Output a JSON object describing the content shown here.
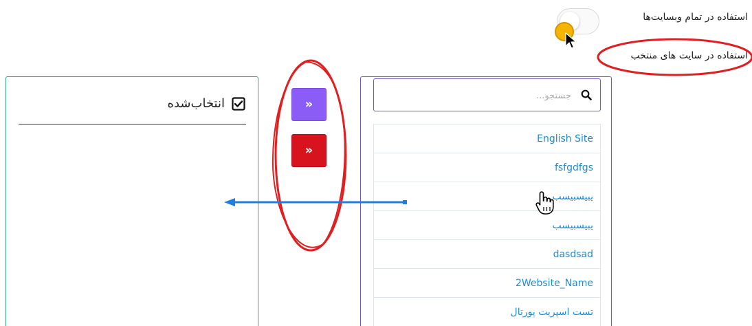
{
  "options": {
    "all_sites_label": "استفاده در تمام وبسایت‌ها",
    "selected_sites_label": "استفاده در سایت های منتخب",
    "toggle_on": false
  },
  "source": {
    "search_placeholder": "جستجو...",
    "items": [
      "English Site",
      "fsfgdfgs",
      "یبیسبیسب",
      "یبیسبیسب",
      "dasdsad",
      "2Website_Name",
      "تست اسپریت پورتال"
    ]
  },
  "actions": {
    "add_label": "»",
    "add_all_label": "»"
  },
  "target": {
    "title": "انتخاب‌شده"
  },
  "colors": {
    "accent_purple": "#8b5cf6",
    "accent_red": "#d7141e",
    "link_blue": "#1a8cd8",
    "annotation_red": "#e02020",
    "annotation_blue": "#1e7fe0",
    "target_border": "#2fa38a"
  },
  "icons": {
    "search": "search-icon",
    "check": "checkbox-checked-icon",
    "pointer": "hand-pointer-icon",
    "arrow": "arrow-cursor-icon"
  }
}
